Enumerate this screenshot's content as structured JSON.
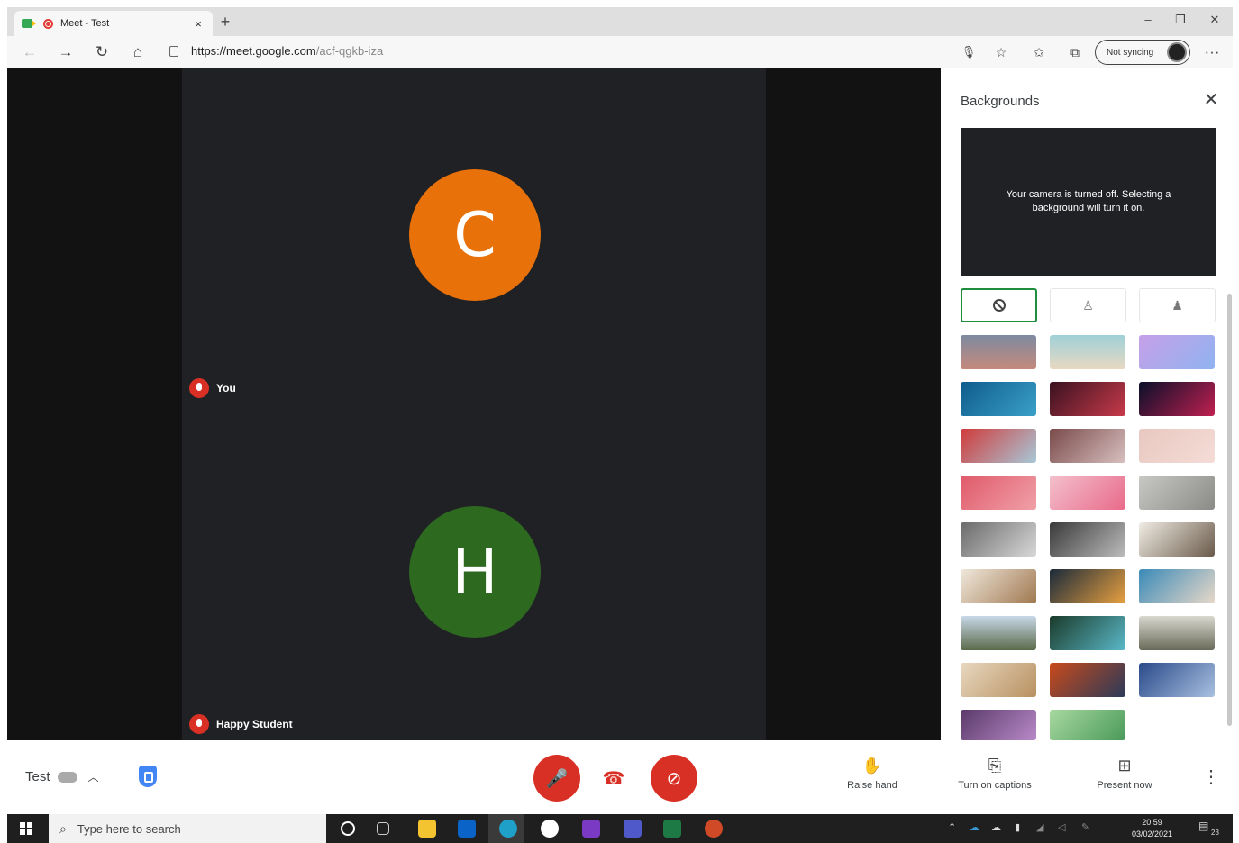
{
  "browser": {
    "tab_title": "Meet - Test",
    "tab_close": "×",
    "new_tab": "+",
    "url_host": "https://meet.google.com",
    "url_path": "/acf-qgkb-iza",
    "sync_label": "Not syncing",
    "more": "···"
  },
  "stage": {
    "participants": [
      {
        "initial": "C",
        "name": "You",
        "color": "#e8710a"
      },
      {
        "initial": "H",
        "name": "Happy Student",
        "color": "#2d6a1f"
      }
    ]
  },
  "panel": {
    "title": "Backgrounds",
    "close": "✕",
    "preview_text": "Your camera is turned off. Selecting a background will turn it on.",
    "options": [
      "no-effect",
      "slight-blur",
      "blur"
    ],
    "backgrounds": [
      "linear-gradient(180deg,#7d8aa0,#c58a7c)",
      "linear-gradient(180deg,#9fd0d8,#e8d9c2)",
      "linear-gradient(135deg,#c6a0e8,#8fb3f0)",
      "linear-gradient(135deg,#0f5c8c,#3aa0c8)",
      "linear-gradient(135deg,#3a1220,#c83a4a)",
      "linear-gradient(135deg,#0a0f2a,#c02050)",
      "linear-gradient(135deg,#d03a3a,#a8c8d8)",
      "linear-gradient(135deg,#7a4a4a,#d8c0c0)",
      "linear-gradient(135deg,#e8c8c0,#f4dcd6)",
      "linear-gradient(135deg,#e05a6a,#f0a0a8)",
      "linear-gradient(135deg,#f4c0cc,#e86a8a)",
      "linear-gradient(135deg,#c8c8c4,#8a8a86)",
      "linear-gradient(135deg,#6a6a6a,#d8d8d8)",
      "linear-gradient(135deg,#3a3a3a,#bcbcbc)",
      "linear-gradient(135deg,#f0ece4,#6a5a4a)",
      "linear-gradient(135deg,#f0e8dc,#a07850)",
      "linear-gradient(135deg,#1a2a3a,#e8a040)",
      "linear-gradient(135deg,#3a8ab8,#e8d8c8)",
      "linear-gradient(180deg,#c8d8e8,#5a6a4a)",
      "linear-gradient(135deg,#1a3a2a,#5ab8c8)",
      "linear-gradient(180deg,#d8d8d0,#6a6a5a)",
      "linear-gradient(135deg,#e8d8c0,#b89060)",
      "linear-gradient(135deg,#c84a1a,#2a3a5a)",
      "linear-gradient(135deg,#2a4a8a,#a8c0e0)",
      "linear-gradient(135deg,#5a3a6a,#b88ac8)",
      "linear-gradient(135deg,#a8d8a0,#4a9a5a)"
    ]
  },
  "bottom": {
    "meeting_name": "Test",
    "raise_hand": "Raise hand",
    "captions": "Turn on captions",
    "present": "Present now"
  },
  "taskbar": {
    "search_placeholder": "Type here to search",
    "time": "20:59",
    "date": "03/02/2021",
    "notifications": "23"
  }
}
